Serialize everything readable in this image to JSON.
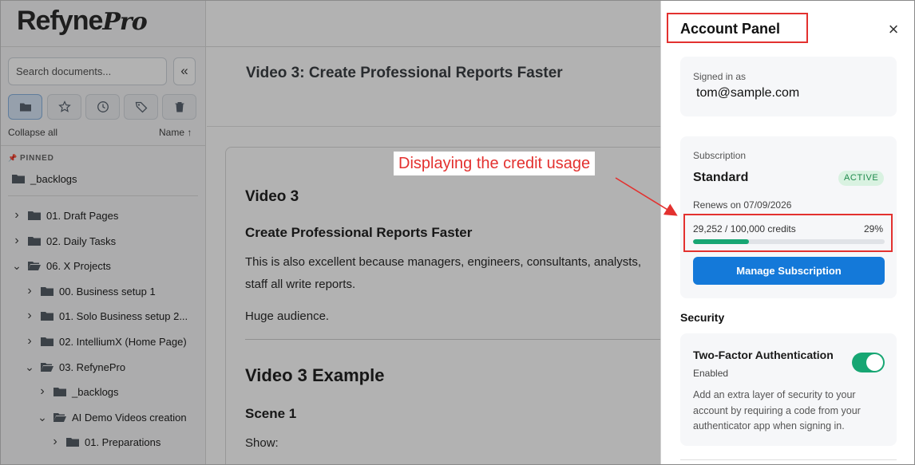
{
  "app": {
    "logo_main": "Refyne",
    "logo_accent": "Pro"
  },
  "sidebar": {
    "search_placeholder": "Search documents...",
    "collapse_glyph": "«",
    "view_icons": [
      {
        "icon": "folder-icon",
        "active": true
      },
      {
        "icon": "star-icon",
        "active": false
      },
      {
        "icon": "clock-icon",
        "active": false
      },
      {
        "icon": "tag-icon",
        "active": false
      },
      {
        "icon": "trash-icon",
        "active": false
      }
    ],
    "collapse_all_label": "Collapse all",
    "sort_label": "Name ↑",
    "pinned_label": "PINNED",
    "pinned_items": [
      {
        "label": "_backlogs"
      }
    ],
    "tree": [
      {
        "label": "01. Draft Pages",
        "level": 0,
        "expanded": false
      },
      {
        "label": "02. Daily Tasks",
        "level": 0,
        "expanded": false
      },
      {
        "label": "06. X Projects",
        "level": 0,
        "expanded": true
      },
      {
        "label": "00. Business setup 1",
        "level": 1,
        "expanded": false
      },
      {
        "label": "01. Solo Business setup 2...",
        "level": 1,
        "expanded": false
      },
      {
        "label": "02. IntelliumX (Home Page)",
        "level": 1,
        "expanded": false
      },
      {
        "label": "03. RefynePro",
        "level": 1,
        "expanded": true
      },
      {
        "label": "_backlogs",
        "level": 2,
        "expanded": false
      },
      {
        "label": "AI Demo Videos creation",
        "level": 2,
        "expanded": true
      },
      {
        "label": "01. Preparations",
        "level": 3,
        "expanded": false
      }
    ]
  },
  "document": {
    "title": "Video 3: Create Professional Reports Faster",
    "heading": "Video 3",
    "subheading": "Create Professional Reports Faster",
    "para1_line1": "This is also excellent because managers, engineers, consultants, analysts,",
    "para1_line2": "staff all write reports.",
    "para2": "Huge audience.",
    "example_heading": "Video 3 Example",
    "scene_heading": "Scene 1",
    "show_label": "Show:"
  },
  "panel": {
    "title": "Account Panel",
    "close_glyph": "×",
    "signed_in_label": "Signed in as",
    "email": "tom@sample.com",
    "subscription_label": "Subscription",
    "plan_name": "Standard",
    "status_badge": "ACTIVE",
    "renews_text": "Renews on 07/09/2026",
    "credits_text": "29,252 / 100,000 credits",
    "usage_percent_text": "29%",
    "usage_fraction": 0.29,
    "manage_button": "Manage Subscription",
    "security_heading": "Security",
    "tfa_title": "Two-Factor Authentication",
    "tfa_status": "Enabled",
    "tfa_enabled": true,
    "tfa_description": "Add an extra layer of security to your account by requiring a code from your authenticator app when signing in."
  },
  "annotation": {
    "label": "Displaying the credit usage",
    "color": "#e3312f"
  },
  "colors": {
    "accent_blue": "#1479d9",
    "success_green": "#17a673"
  }
}
